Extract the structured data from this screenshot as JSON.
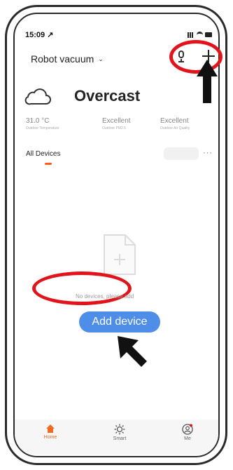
{
  "status": {
    "time": "15:09 ↗"
  },
  "header": {
    "home_name": "Robot vacuum",
    "chevron": "⌄"
  },
  "weather": {
    "condition": "Overcast"
  },
  "stats": [
    {
      "value": "31.0 °C",
      "label": "Outdoor Temperature"
    },
    {
      "value": "Excellent",
      "label": "Outdoor PM2.5"
    },
    {
      "value": "Excellent",
      "label": "Outdoor Air Quality"
    }
  ],
  "devices": {
    "tab_label": "All Devices",
    "more": "···"
  },
  "empty_state": {
    "message": "No devices, please add",
    "button_label": "Add device"
  },
  "tab_bar": {
    "items": [
      {
        "label": "Home",
        "icon": "home-icon"
      },
      {
        "label": "Smart",
        "icon": "smart-icon"
      },
      {
        "label": "Me",
        "icon": "me-icon"
      }
    ]
  },
  "colors": {
    "accent": "#f06a1f",
    "button": "#4e8ee8",
    "annotation": "#e3131b"
  }
}
